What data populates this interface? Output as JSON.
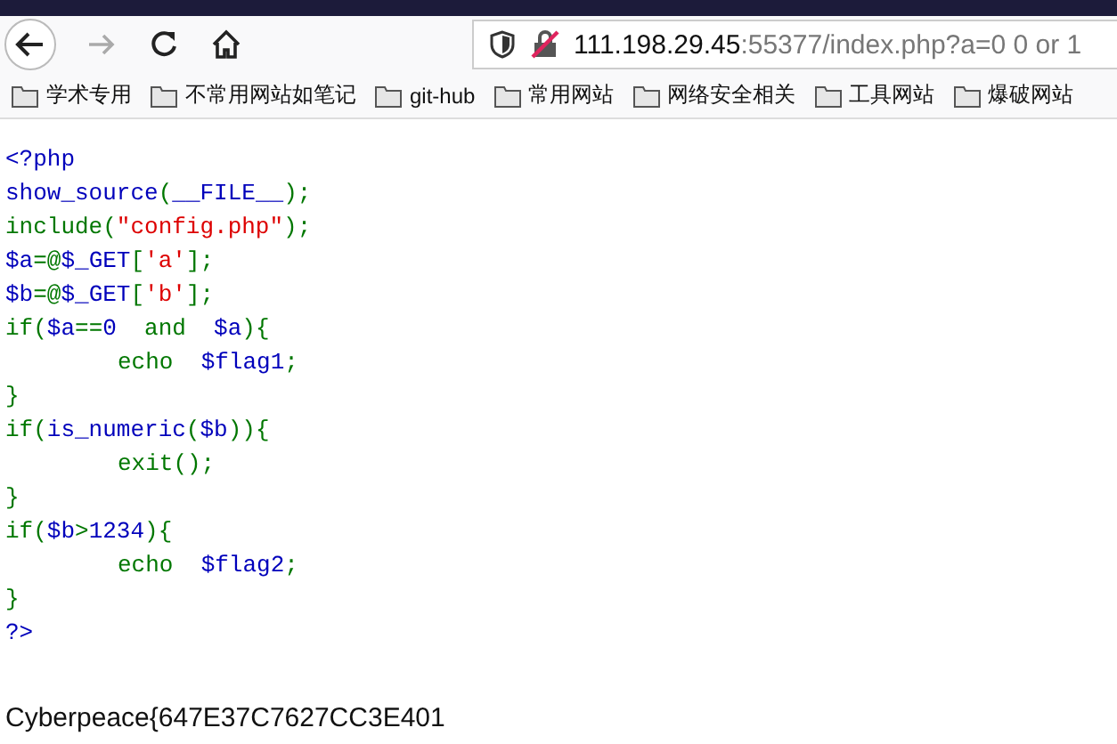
{
  "address_bar": {
    "host": "111.198.29.45",
    "rest": ":55377/index.php?a=0 0 or 1"
  },
  "bookmarks": [
    "学术专用",
    "不常用网站如笔记",
    "git-hub",
    "常用网站",
    "网络安全相关",
    "工具网站",
    "爆破网站"
  ],
  "code_lines": [
    {
      "indent": false,
      "tokens": [
        {
          "kind": "default",
          "text": "<?php"
        }
      ]
    },
    {
      "indent": false,
      "tokens": [
        {
          "kind": "default",
          "text": "show_source"
        },
        {
          "kind": "keyword",
          "text": "("
        },
        {
          "kind": "default",
          "text": "__FILE__"
        },
        {
          "kind": "keyword",
          "text": ");"
        }
      ]
    },
    {
      "indent": false,
      "tokens": [
        {
          "kind": "keyword",
          "text": "include("
        },
        {
          "kind": "string",
          "text": "\"config.php\""
        },
        {
          "kind": "keyword",
          "text": ");"
        }
      ]
    },
    {
      "indent": false,
      "tokens": [
        {
          "kind": "default",
          "text": "$a"
        },
        {
          "kind": "keyword",
          "text": "=@"
        },
        {
          "kind": "default",
          "text": "$_GET"
        },
        {
          "kind": "keyword",
          "text": "["
        },
        {
          "kind": "string",
          "text": "'a'"
        },
        {
          "kind": "keyword",
          "text": "];"
        }
      ]
    },
    {
      "indent": false,
      "tokens": [
        {
          "kind": "default",
          "text": "$b"
        },
        {
          "kind": "keyword",
          "text": "=@"
        },
        {
          "kind": "default",
          "text": "$_GET"
        },
        {
          "kind": "keyword",
          "text": "["
        },
        {
          "kind": "string",
          "text": "'b'"
        },
        {
          "kind": "keyword",
          "text": "];"
        }
      ]
    },
    {
      "indent": false,
      "tokens": [
        {
          "kind": "keyword",
          "text": "if("
        },
        {
          "kind": "default",
          "text": "$a"
        },
        {
          "kind": "keyword",
          "text": "=="
        },
        {
          "kind": "default",
          "text": "0"
        },
        {
          "kind": "keyword",
          "text": "  and  "
        },
        {
          "kind": "default",
          "text": "$a"
        },
        {
          "kind": "keyword",
          "text": "){"
        }
      ]
    },
    {
      "indent": true,
      "tokens": [
        {
          "kind": "keyword",
          "text": "echo  "
        },
        {
          "kind": "default",
          "text": "$flag1"
        },
        {
          "kind": "keyword",
          "text": ";"
        }
      ]
    },
    {
      "indent": false,
      "tokens": [
        {
          "kind": "keyword",
          "text": "}"
        }
      ]
    },
    {
      "indent": false,
      "tokens": [
        {
          "kind": "keyword",
          "text": "if("
        },
        {
          "kind": "default",
          "text": "is_numeric"
        },
        {
          "kind": "keyword",
          "text": "("
        },
        {
          "kind": "default",
          "text": "$b"
        },
        {
          "kind": "keyword",
          "text": ")){"
        }
      ]
    },
    {
      "indent": true,
      "tokens": [
        {
          "kind": "keyword",
          "text": "exit();"
        }
      ]
    },
    {
      "indent": false,
      "tokens": [
        {
          "kind": "keyword",
          "text": "}"
        }
      ]
    },
    {
      "indent": false,
      "tokens": [
        {
          "kind": "keyword",
          "text": "if("
        },
        {
          "kind": "default",
          "text": "$b"
        },
        {
          "kind": "keyword",
          "text": ">"
        },
        {
          "kind": "default",
          "text": "1234"
        },
        {
          "kind": "keyword",
          "text": "){"
        }
      ]
    },
    {
      "indent": true,
      "tokens": [
        {
          "kind": "keyword",
          "text": "echo  "
        },
        {
          "kind": "default",
          "text": "$flag2"
        },
        {
          "kind": "keyword",
          "text": ";"
        }
      ]
    },
    {
      "indent": false,
      "tokens": [
        {
          "kind": "keyword",
          "text": "}"
        }
      ]
    },
    {
      "indent": false,
      "tokens": [
        {
          "kind": "default",
          "text": "?>"
        }
      ]
    }
  ],
  "output": "Cyberpeace{647E37C7627CC3E401"
}
